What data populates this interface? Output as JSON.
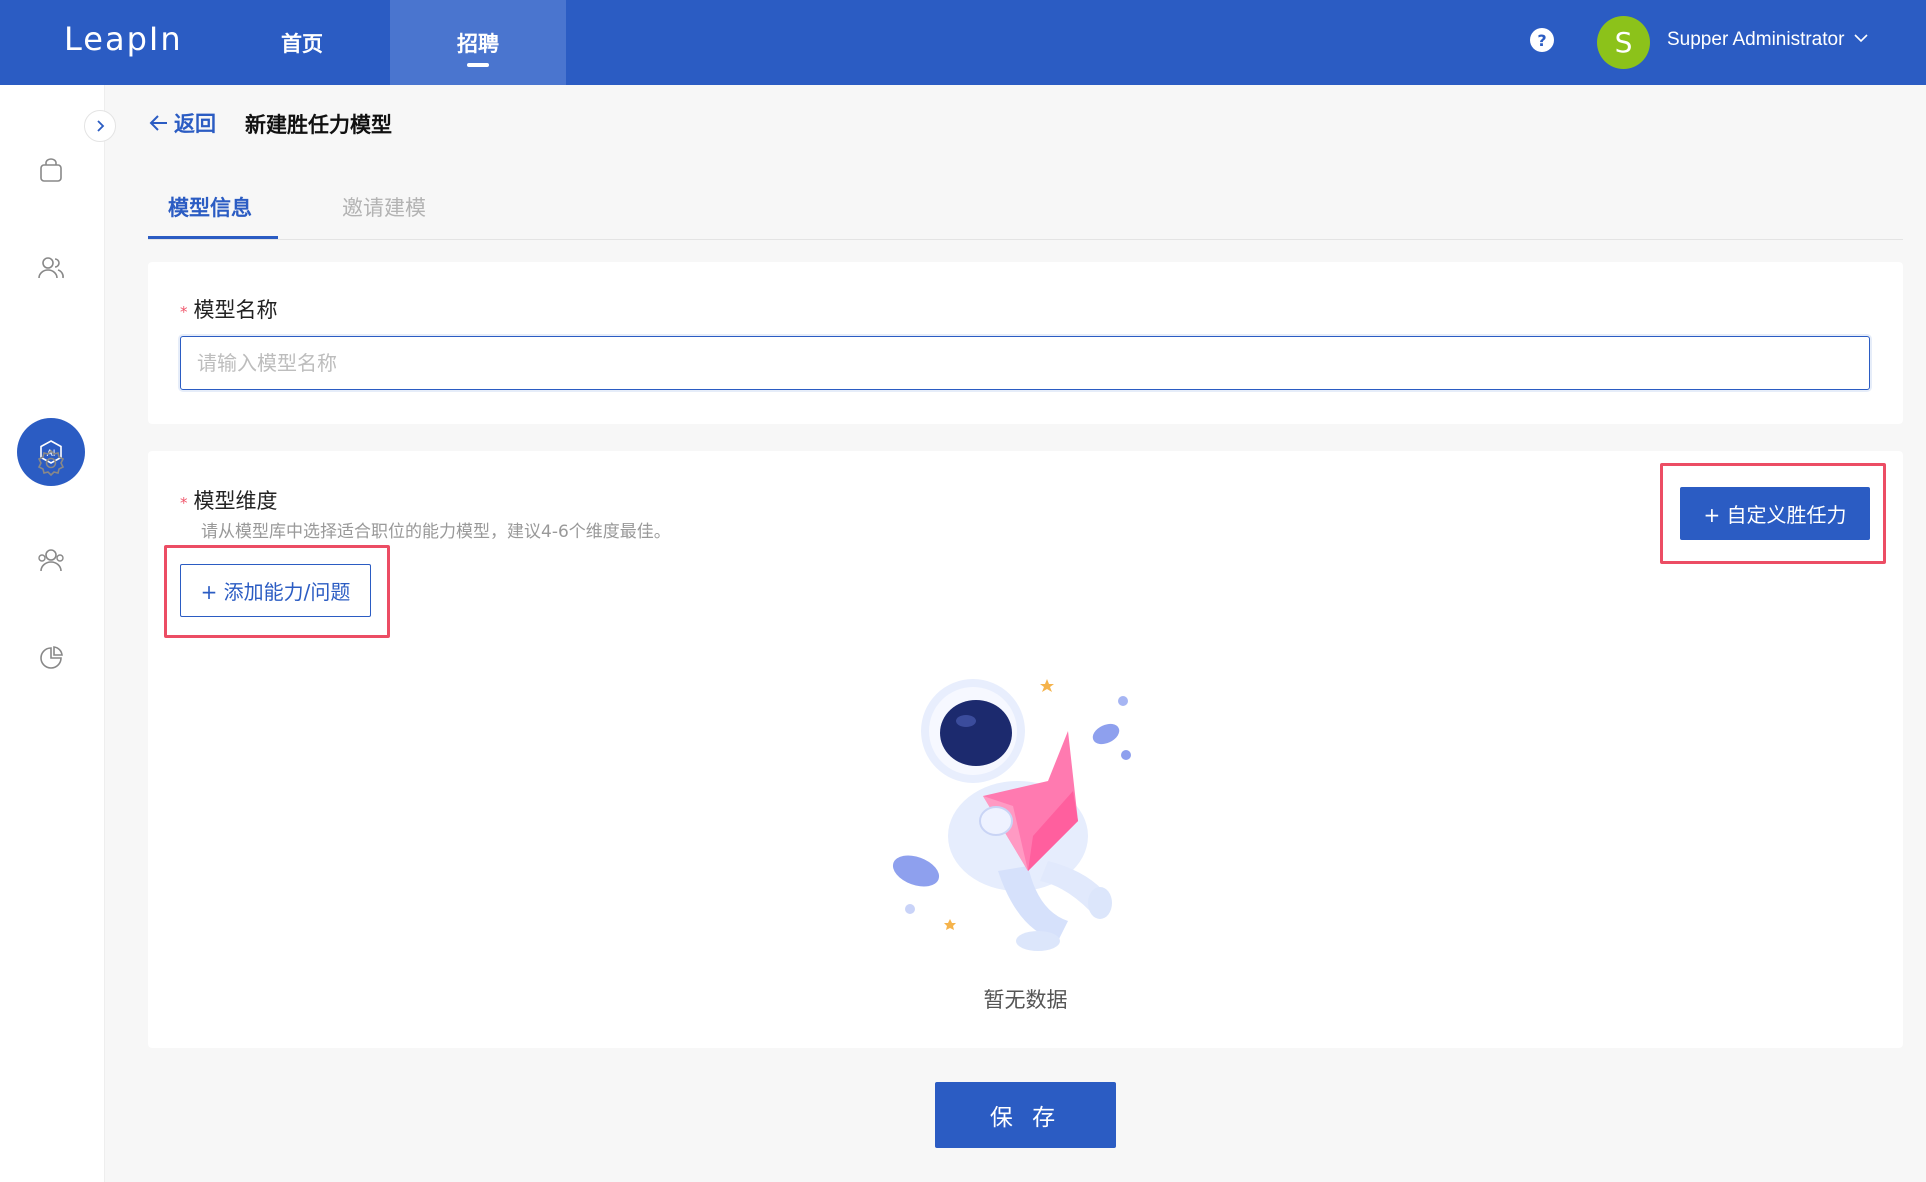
{
  "app": {
    "logo": "LeapIn"
  },
  "nav": {
    "items": [
      {
        "label": "首页"
      },
      {
        "label": "招聘"
      }
    ]
  },
  "user": {
    "avatar_letter": "S",
    "name": "Supper Administrator",
    "help": "?"
  },
  "sidebar": {
    "items": [
      {
        "icon": "bag-icon"
      },
      {
        "icon": "people-icon"
      },
      {
        "icon": "ai-icon"
      },
      {
        "icon": "gear-icon"
      },
      {
        "icon": "group-icon"
      },
      {
        "icon": "pie-chart-icon"
      }
    ],
    "active": "ai-icon"
  },
  "header": {
    "back_label": "返回",
    "title": "新建胜任力模型"
  },
  "tabs": [
    {
      "label": "模型信息"
    },
    {
      "label": "邀请建模"
    }
  ],
  "form": {
    "name_label": "模型名称",
    "required_mark": "*",
    "name_placeholder": "请输入模型名称",
    "name_value": "",
    "dimension_label": "模型维度",
    "dimension_hint": "请从模型库中选择适合职位的能力模型，建议4-6个维度最佳。",
    "add_button": "+ 添加能力/问题",
    "custom_button": "+ 自定义胜任力",
    "empty_text": "暂无数据",
    "save_button": "保 存"
  },
  "colors": {
    "primary": "#2b5cc3",
    "avatar": "#8cc21a",
    "highlight": "#ec4d64",
    "required": "#f0576c"
  }
}
